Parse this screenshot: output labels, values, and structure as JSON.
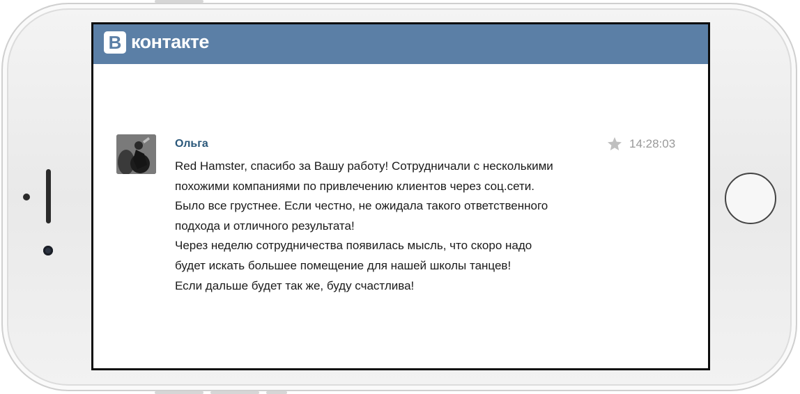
{
  "header": {
    "logo_letter": "B",
    "logo_text": "контакте",
    "color": "#5b7fa6"
  },
  "post": {
    "author": "Ольга",
    "time": "14:28:03",
    "star_icon": "star-icon",
    "lines": [
      "Red Hamster, спасибо за Вашу работу! Сотрудничали с несколькими",
      "похожими компаниями по привлечению клиентов через соц.сети.",
      "Было все грустнее. Если честно, не ожидала такого ответственного",
      "подхода и отличного результата!",
      "Через неделю сотрудничества появилась мысль, что скоро надо",
      "будет искать большее помещение для нашей школы танцев!",
      "Если дальше будет так же, буду счастлива!"
    ]
  }
}
